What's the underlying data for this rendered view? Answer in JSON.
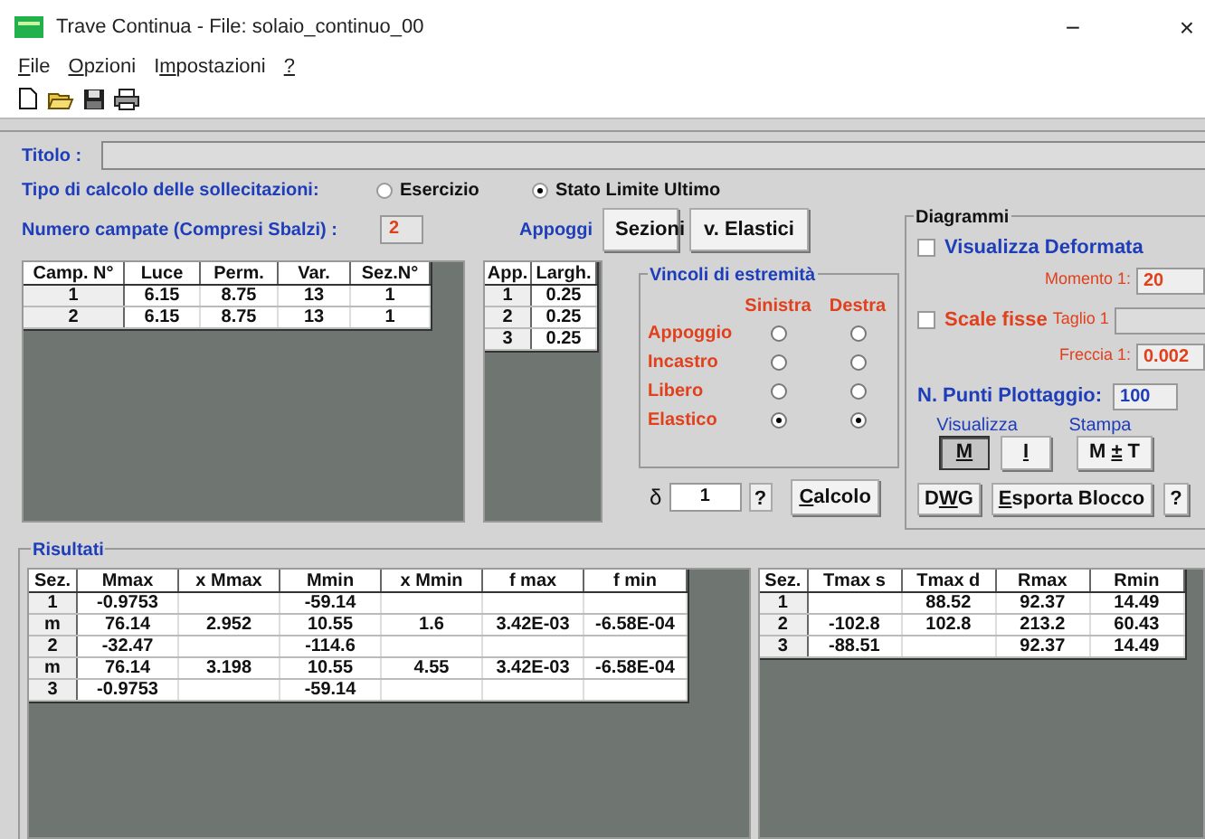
{
  "window": {
    "title": "Trave Continua - File: solaio_continuo_00",
    "controls": [
      {
        "kind": "minimize",
        "label": "−"
      },
      {
        "kind": "close",
        "label": "×"
      }
    ]
  },
  "menu": [
    {
      "key": "F",
      "rest": "ile"
    },
    {
      "key": "O",
      "rest": "pzioni"
    },
    {
      "lead": "I",
      "key": "m",
      "rest": "postazioni"
    },
    {
      "key": "?"
    }
  ],
  "title_field": {
    "label": "Titolo :"
  },
  "calc_type": {
    "label": "Tipo di calcolo delle sollecitazioni:",
    "options": [
      {
        "label": "Esercizio",
        "selected": false
      },
      {
        "label": "Stato Limite Ultimo",
        "selected": true
      }
    ]
  },
  "spans": {
    "label": "Numero campate (Compresi Sbalzi) :",
    "value": "2"
  },
  "spans_table": {
    "columns": [
      "Camp. N°",
      "Luce",
      "Perm.",
      "Var.",
      "Sez.N°"
    ],
    "rows": [
      [
        "1",
        "6.15",
        "8.75",
        "13",
        "1"
      ],
      [
        "2",
        "6.15",
        "8.75",
        "13",
        "1"
      ]
    ]
  },
  "supports": {
    "label": "Appoggi",
    "columns": [
      "App.",
      "Largh."
    ],
    "rows": [
      [
        "1",
        "0.25"
      ],
      [
        "2",
        "0.25"
      ],
      [
        "3",
        "0.25"
      ]
    ]
  },
  "top_buttons": [
    {
      "label": "Sezioni"
    },
    {
      "label": "v. Elastici"
    }
  ],
  "constraints": {
    "title": "Vincoli di estremità",
    "columns": [
      "Sinistra",
      "Destra"
    ],
    "rows": [
      {
        "label": "Appoggio",
        "sides": [
          {
            "selected": false
          },
          {
            "selected": false
          }
        ]
      },
      {
        "label": "Incastro",
        "sides": [
          {
            "selected": false
          },
          {
            "selected": false
          }
        ]
      },
      {
        "label": "Libero",
        "sides": [
          {
            "selected": false
          },
          {
            "selected": false
          }
        ]
      },
      {
        "label": "Elastico",
        "sides": [
          {
            "selected": true
          },
          {
            "selected": true
          }
        ]
      }
    ]
  },
  "delta": {
    "symbol": "δ",
    "value": "1",
    "help": "?",
    "calc_button": {
      "key": "C",
      "rest": "alcolo"
    }
  },
  "diagrams": {
    "title": "Diagrammi",
    "show_deformed": {
      "label": "Visualizza Deformata",
      "checked": false
    },
    "moment": {
      "label": "Momento 1:",
      "value": "20"
    },
    "fixed_scale": {
      "label": "Scale fisse",
      "checked": false
    },
    "shear": {
      "label": "Taglio 1"
    },
    "deflection": {
      "label": "Freccia 1:",
      "value": "0.002"
    },
    "plot_points": {
      "label": "N. Punti Plottaggio:",
      "value": "100"
    },
    "view_label": "Visualizza",
    "print_label": "Stampa",
    "view_buttons": [
      {
        "key": "M",
        "pressed": true
      },
      {
        "key": "I",
        "pressed": false
      },
      {
        "lead": "M ",
        "key": "±",
        "rest": " T",
        "pressed": false
      }
    ],
    "actions": [
      {
        "lead": "D",
        "key": "W",
        "rest": "G"
      },
      {
        "key": "E",
        "rest": "sporta Blocco"
      },
      {
        "rest": "?"
      }
    ]
  },
  "results": {
    "title": "Risultati",
    "moments_table": {
      "columns": [
        "Sez.",
        "Mmax",
        "x Mmax",
        "Mmin",
        "x Mmin",
        "f max",
        "f min"
      ],
      "rows": [
        [
          "1",
          "-0.9753",
          "",
          "-59.14",
          "",
          "",
          ""
        ],
        [
          "m",
          "76.14",
          "2.952",
          "10.55",
          "1.6",
          "3.42E-03",
          "-6.58E-04"
        ],
        [
          "2",
          "-32.47",
          "",
          "-114.6",
          "",
          "",
          ""
        ],
        [
          "m",
          "76.14",
          "3.198",
          "10.55",
          "4.55",
          "3.42E-03",
          "-6.58E-04"
        ],
        [
          "3",
          "-0.9753",
          "",
          "-59.14",
          "",
          "",
          ""
        ]
      ]
    },
    "shear_table": {
      "columns": [
        "Sez.",
        "Tmax s",
        "Tmax d",
        "Rmax",
        "Rmin"
      ],
      "rows": [
        [
          "1",
          "",
          "88.52",
          "92.37",
          "14.49"
        ],
        [
          "2",
          "-102.8",
          "102.8",
          "213.2",
          "60.43"
        ],
        [
          "3",
          "-88.51",
          "",
          "92.37",
          "14.49"
        ]
      ]
    }
  }
}
